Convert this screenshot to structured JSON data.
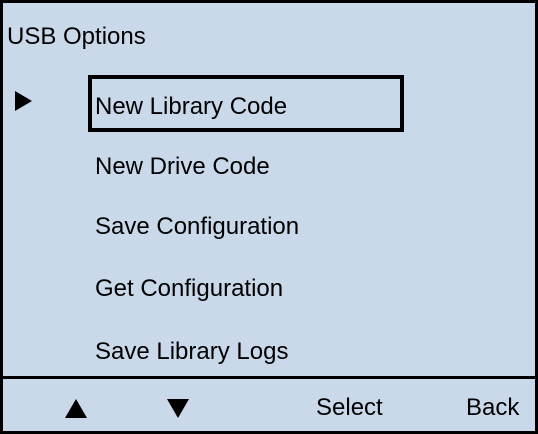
{
  "screen": {
    "title": "USB Options",
    "items": [
      {
        "label": "New Library Code",
        "selected": true
      },
      {
        "label": "New Drive Code",
        "selected": false
      },
      {
        "label": "Save Configuration",
        "selected": false
      },
      {
        "label": "Get Configuration",
        "selected": false
      },
      {
        "label": "Save Library Logs",
        "selected": false
      }
    ]
  },
  "softkeys": {
    "up_icon": "up-arrow-icon",
    "down_icon": "down-arrow-icon",
    "select_label": "Select",
    "back_label": "Back"
  },
  "colors": {
    "background": "#c9d9ea",
    "foreground": "#000000"
  }
}
